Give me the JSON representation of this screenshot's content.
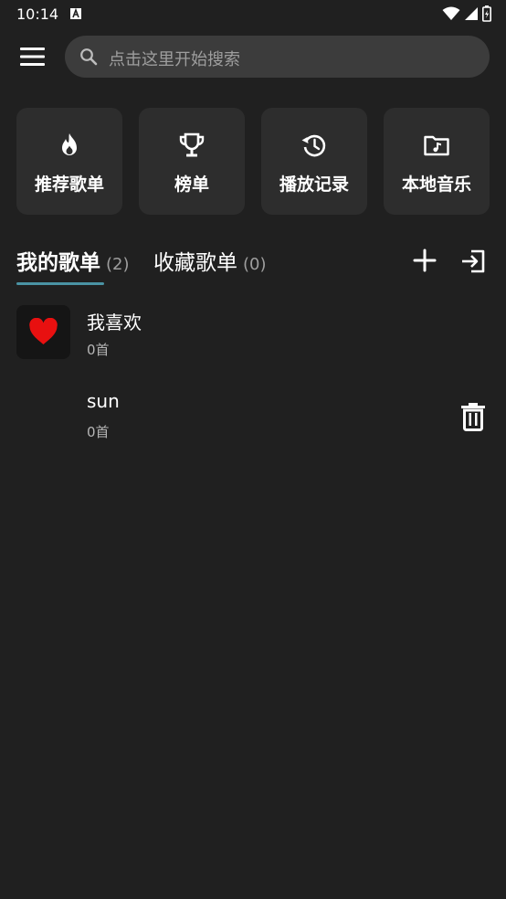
{
  "status_bar": {
    "time": "10:14"
  },
  "search": {
    "placeholder": "点击这里开始搜索"
  },
  "quick_actions": [
    {
      "label": "推荐歌单",
      "icon": "fire-icon"
    },
    {
      "label": "榜单",
      "icon": "trophy-icon"
    },
    {
      "label": "播放记录",
      "icon": "history-icon"
    },
    {
      "label": "本地音乐",
      "icon": "music-folder-icon"
    }
  ],
  "tabs": [
    {
      "label": "我的歌单",
      "count": "(2)",
      "active": true
    },
    {
      "label": "收藏歌单",
      "count": "(0)",
      "active": false
    }
  ],
  "playlists": [
    {
      "title": "我喜欢",
      "count": "0首",
      "cover": "heart-icon"
    },
    {
      "title": "sun",
      "count": "0首"
    }
  ],
  "colors": {
    "background": "#202020",
    "tile": "#2d2d2d",
    "search": "#3c3c3c",
    "accent_underline": "#4a93a4",
    "heart": "#e81010"
  }
}
